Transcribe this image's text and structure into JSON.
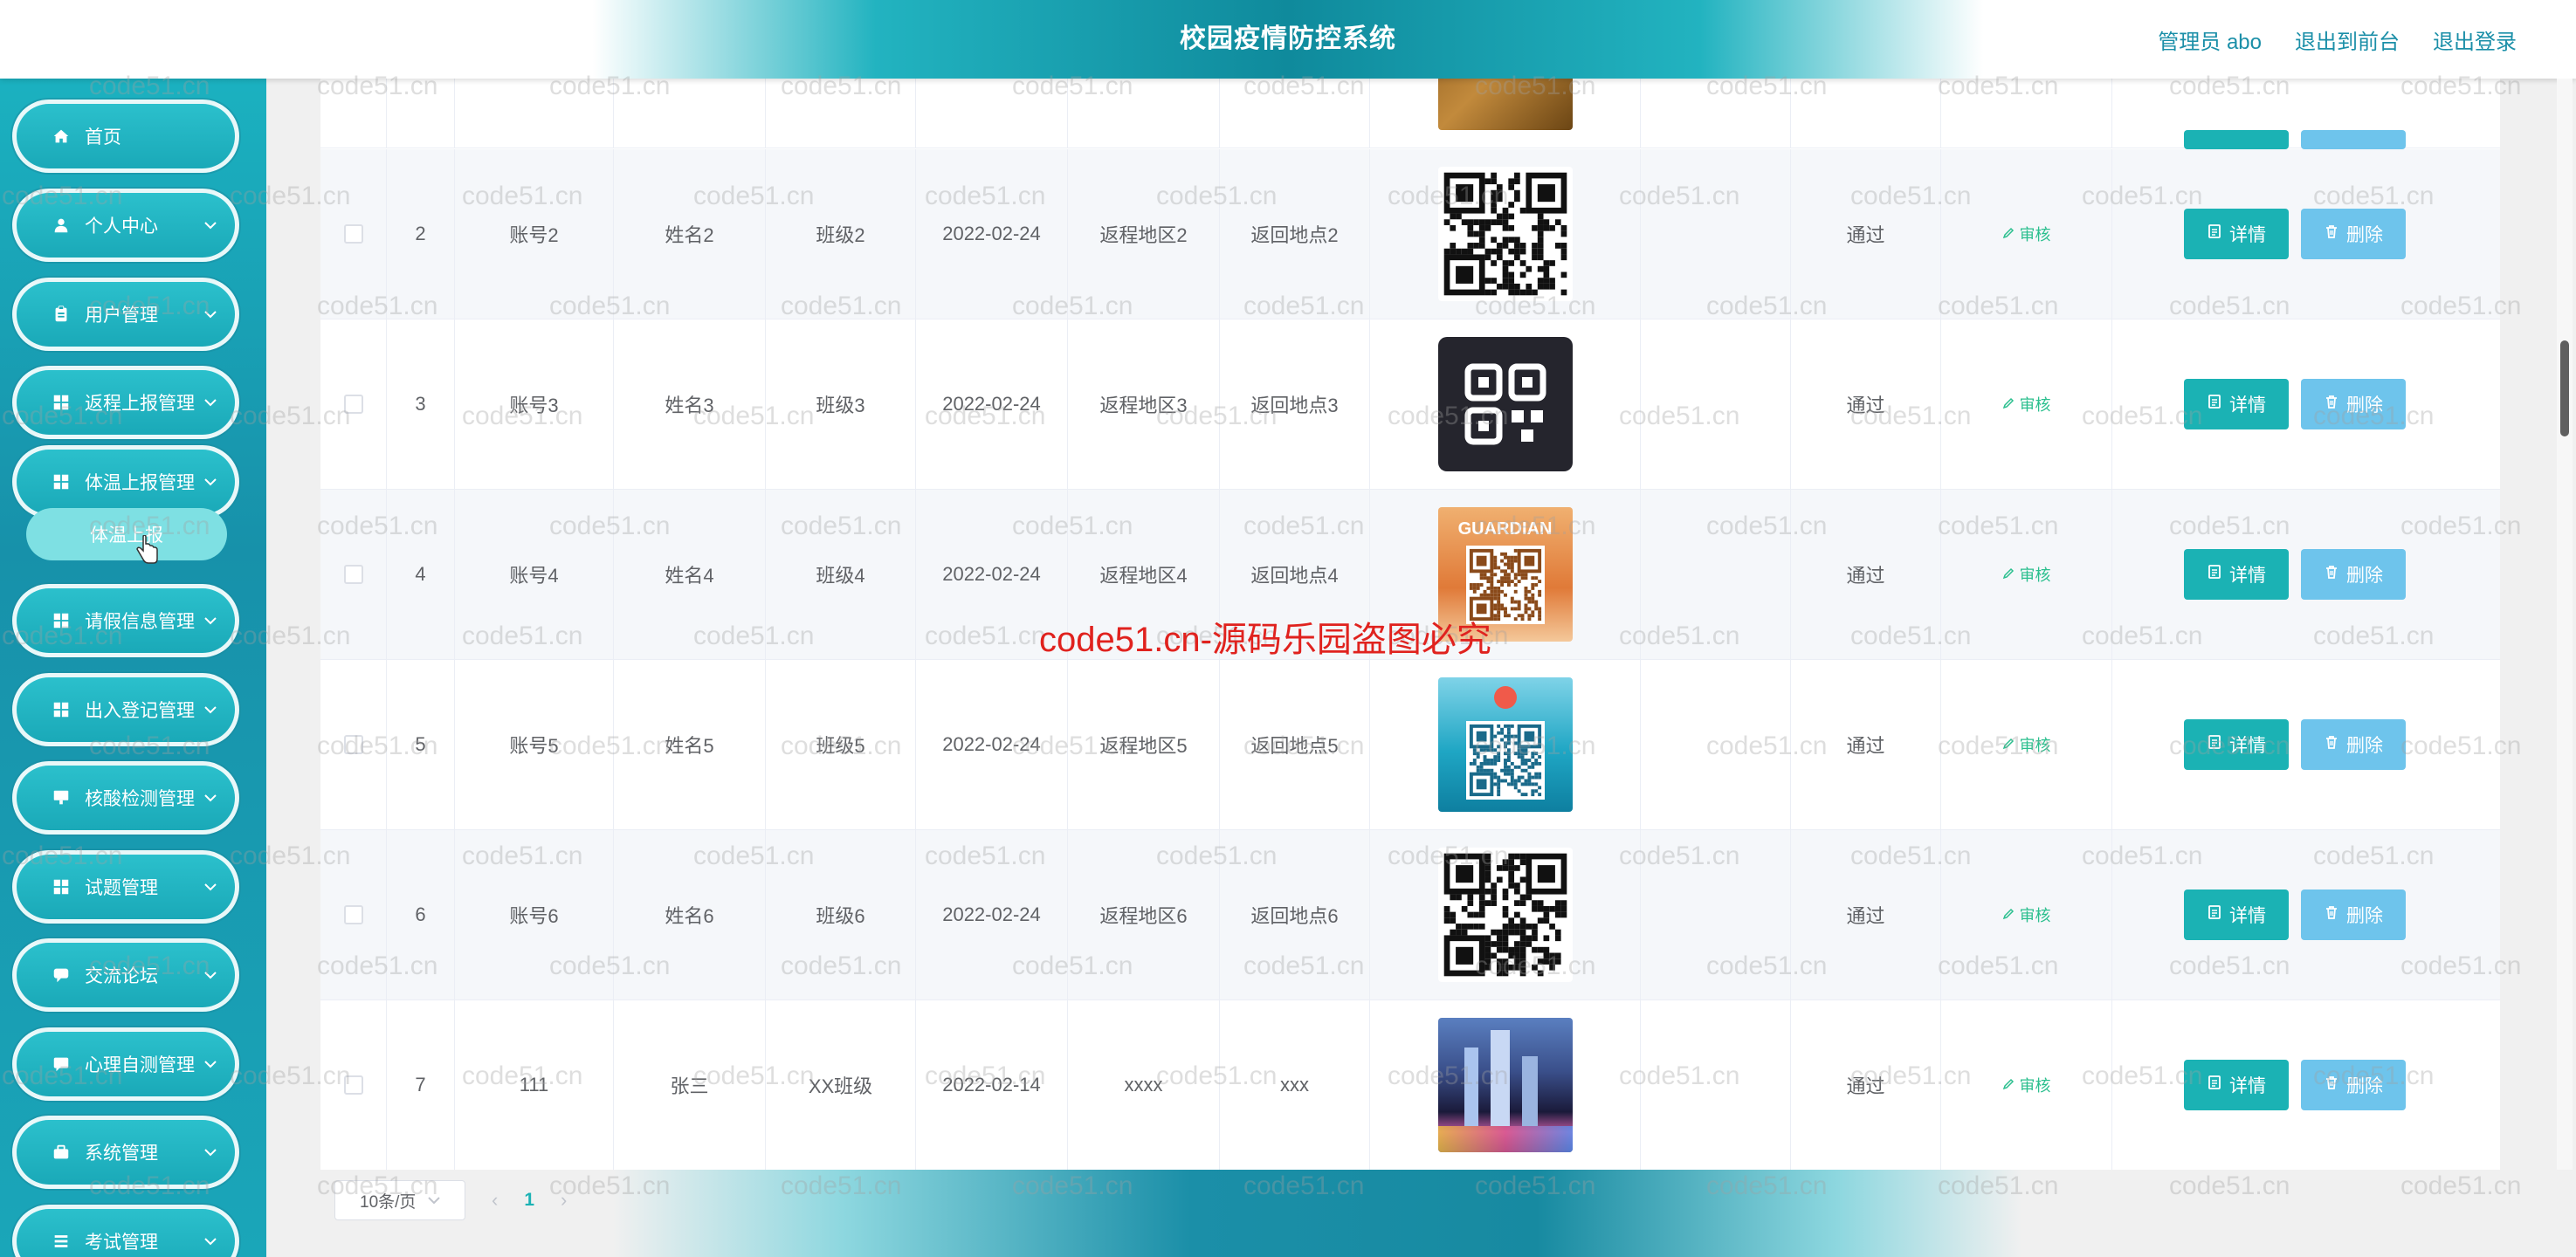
{
  "header": {
    "title": "校园疫情防控系统",
    "links": [
      "管理员 abo",
      "退出到前台",
      "退出登录"
    ]
  },
  "sidebar": {
    "items": [
      {
        "label": "首页",
        "icon": "home-icon",
        "chevron": false
      },
      {
        "label": "个人中心",
        "icon": "user-icon",
        "chevron": true
      },
      {
        "label": "用户管理",
        "icon": "clipboard-icon",
        "chevron": true
      },
      {
        "label": "返程上报管理",
        "icon": "grid-icon",
        "chevron": true
      },
      {
        "label": "体温上报管理",
        "icon": "grid-icon",
        "chevron": true
      },
      {
        "label": "请假信息管理",
        "icon": "grid-icon",
        "chevron": true
      },
      {
        "label": "出入登记管理",
        "icon": "grid-icon",
        "chevron": true
      },
      {
        "label": "核酸检测管理",
        "icon": "monitor-icon",
        "chevron": true
      },
      {
        "label": "试题管理",
        "icon": "grid-icon",
        "chevron": true
      },
      {
        "label": "交流论坛",
        "icon": "chat-icon",
        "chevron": true
      },
      {
        "label": "心理自测管理",
        "icon": "message-icon",
        "chevron": true
      },
      {
        "label": "系统管理",
        "icon": "briefcase-icon",
        "chevron": true
      },
      {
        "label": "考试管理",
        "icon": "list-icon",
        "chevron": true
      }
    ],
    "submenu": {
      "label": "体温上报"
    }
  },
  "table": {
    "rows": [
      {
        "index": "2",
        "account": "账号2",
        "name": "姓名2",
        "class": "班级2",
        "date": "2022-02-24",
        "area": "返程地区2",
        "location": "返回地点2",
        "status": "通过",
        "audit": "审核",
        "image": "qr-black"
      },
      {
        "index": "3",
        "account": "账号3",
        "name": "姓名3",
        "class": "班级3",
        "date": "2022-02-24",
        "area": "返程地区3",
        "location": "返回地点3",
        "status": "通过",
        "audit": "审核",
        "image": "qr-dark-tile"
      },
      {
        "index": "4",
        "account": "账号4",
        "name": "姓名4",
        "class": "班级4",
        "date": "2022-02-24",
        "area": "返程地区4",
        "location": "返回地点4",
        "status": "通过",
        "audit": "审核",
        "image": "qr-orange"
      },
      {
        "index": "5",
        "account": "账号5",
        "name": "姓名5",
        "class": "班级5",
        "date": "2022-02-24",
        "area": "返程地区5",
        "location": "返回地点5",
        "status": "通过",
        "audit": "审核",
        "image": "qr-sea"
      },
      {
        "index": "6",
        "account": "账号6",
        "name": "姓名6",
        "class": "班级6",
        "date": "2022-02-24",
        "area": "返程地区6",
        "location": "返回地点6",
        "status": "通过",
        "audit": "审核",
        "image": "qr-black"
      },
      {
        "index": "7",
        "account": "111",
        "name": "张三",
        "class": "XX班级",
        "date": "2022-02-14",
        "area": "xxxx",
        "location": "xxx",
        "status": "通过",
        "audit": "审核",
        "image": "city-night"
      }
    ],
    "detail_label": "详情",
    "delete_label": "删除"
  },
  "pagination": {
    "page_size": "10条/页",
    "current_page": "1"
  },
  "watermark": {
    "text": "code51.cn",
    "banner": "code51.cn-源码乐园盗图必究"
  },
  "colors": {
    "accent": "#1bb2b4",
    "delete": "#6ec4ec",
    "audit": "#2bbf8e",
    "banner": "#e0221e"
  }
}
